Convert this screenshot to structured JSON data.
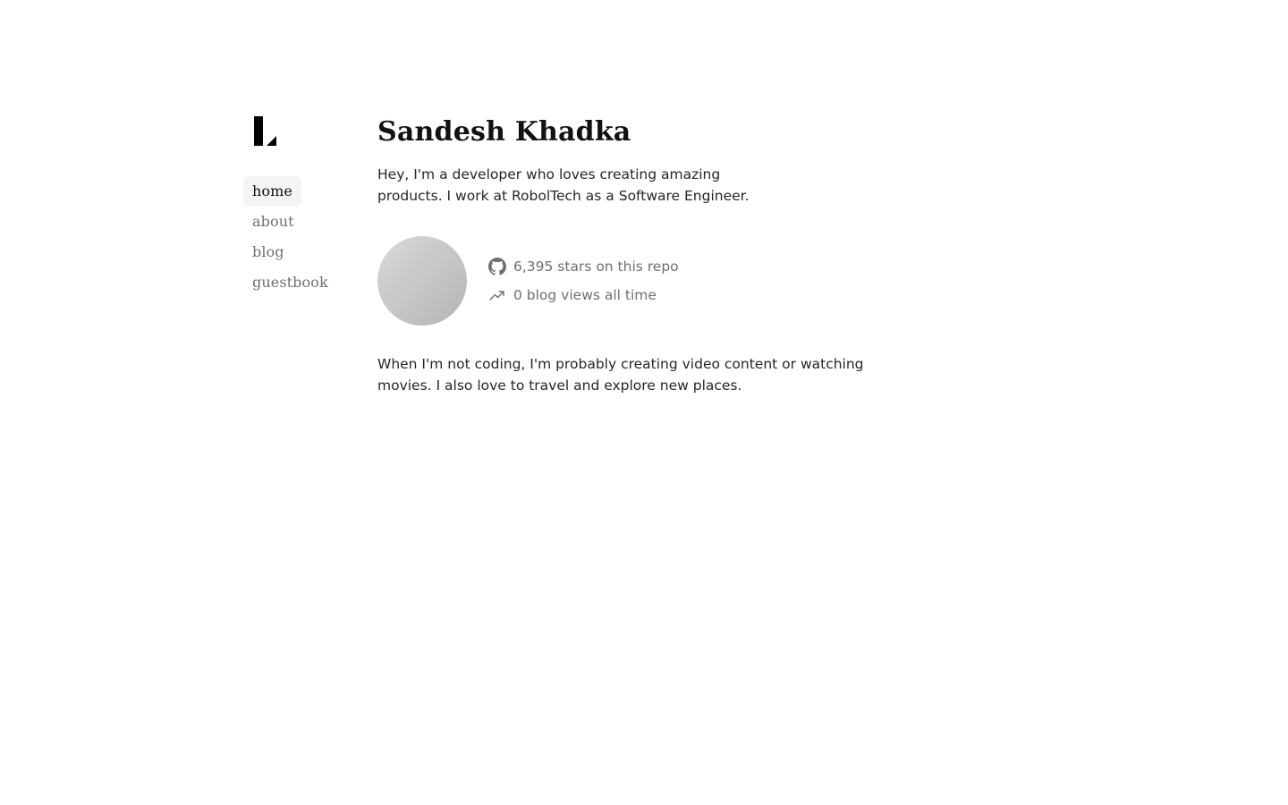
{
  "nav": {
    "items": [
      {
        "label": "home",
        "active": true
      },
      {
        "label": "about",
        "active": false
      },
      {
        "label": "blog",
        "active": false
      },
      {
        "label": "guestbook",
        "active": false
      }
    ]
  },
  "main": {
    "title": "Sandesh Khadka",
    "intro": "Hey, I'm a developer who loves creating amazing products. I work at RobolTech as a Software Engineer.",
    "stats": {
      "github": "6,395 stars on this repo",
      "views": "0 blog views all time"
    },
    "outro": "When I'm not coding, I'm probably creating video content or watching movies. I also love to travel and explore new places."
  },
  "icons": {
    "logo": "logo-icon",
    "github": "github-icon",
    "views": "trending-up-icon"
  },
  "colors": {
    "text_primary": "#111111",
    "text_muted": "#6f6f6f",
    "active_bg": "#f4f4f4"
  }
}
